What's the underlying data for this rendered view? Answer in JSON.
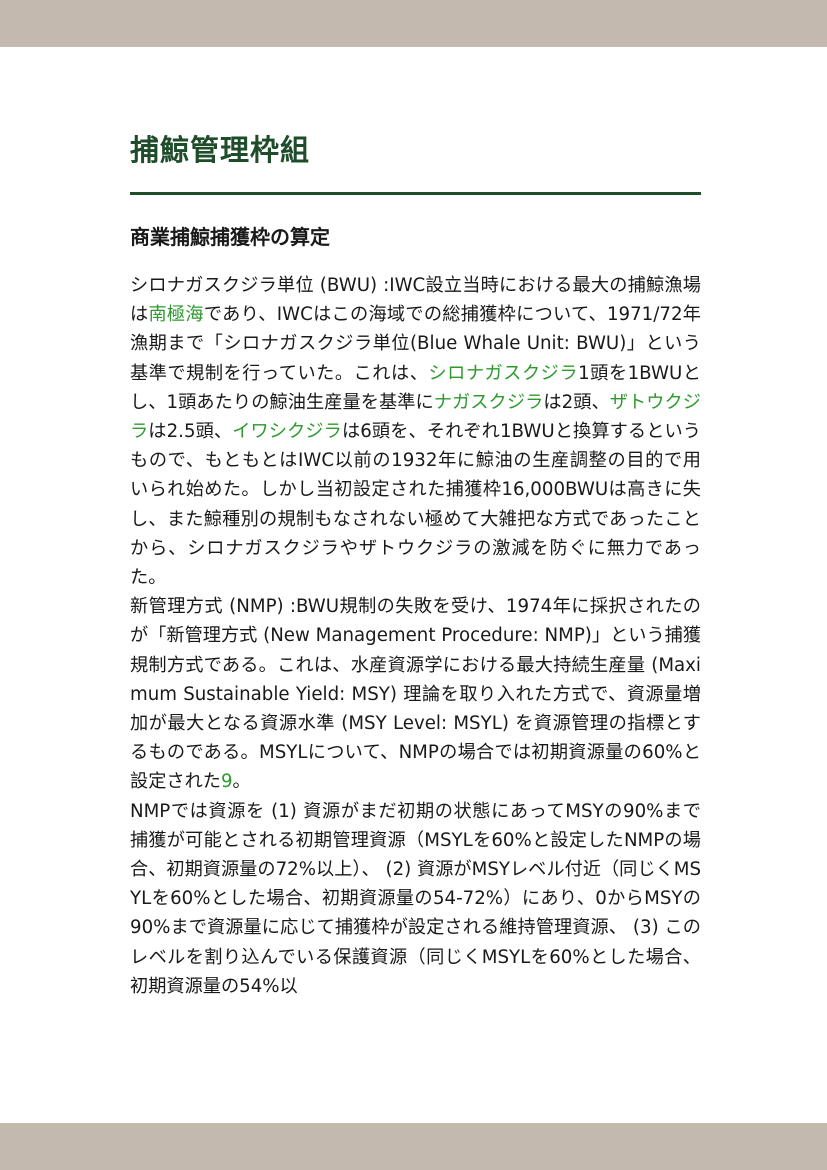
{
  "section_title": "捕鯨管理枠組",
  "subsection_title": "商業捕鯨捕獲枠の算定",
  "paragraphs": [
    [
      {
        "t": "シロナガスクジラ単位 (BWU) :IWC設立当時における最大の捕鯨漁場は"
      },
      {
        "t": "南極海",
        "link": true
      },
      {
        "t": "であり、IWCはこの海域での総捕獲枠について、1971/72年漁期まで「シロナガスクジラ単位(Blue Whale Unit: BWU)」という基準で規制を行っていた。これは、"
      },
      {
        "t": "シロナガスクジラ",
        "link": true
      },
      {
        "t": "1頭を1BWUとし、1頭あたりの鯨油生産量を基準に"
      },
      {
        "t": "ナガスクジラ",
        "link": true
      },
      {
        "t": "は2頭、"
      },
      {
        "t": "ザトウクジラ",
        "link": true
      },
      {
        "t": "は2.5頭、"
      },
      {
        "t": "イワシクジラ",
        "link": true
      },
      {
        "t": "は6頭を、それぞれ1BWUと換算するというもので、もともとはIWC以前の1932年に鯨油の生産調整の目的で用いられ始めた。しかし当初設定された捕獲枠16,000BWUは高きに失し、また鯨種別の規制もなされない極めて大雑把な方式であったことから、シロナガスクジラやザトウクジラの激減を防ぐに無力であった。"
      }
    ],
    [
      {
        "t": "新管理方式 (NMP) :BWU規制の失敗を受け、1974年に採択されたのが「新管理方式 (New Management Procedure: NMP)」という捕獲規制方式である。これは、水産資源学における最大持続生産量 (Maximum Sustainable Yield: MSY) 理論を取り入れた方式で、資源量増加が最大となる資源水準 (MSY Level: MSYL) を資源管理の指標とするものである。MSYLについて、NMPの場合では初期資源量の60%と設定された"
      },
      {
        "t": "9",
        "link": true
      },
      {
        "t": "。"
      }
    ],
    [
      {
        "t": "NMPでは資源を (1) 資源がまだ初期の状態にあってMSYの90%まで捕獲が可能とされる初期管理資源（MSYLを60%と設定したNMPの場合、初期資源量の72%以上）、 (2) 資源がMSYレベル付近（同じくMSYLを60%とした場合、初期資源量の54-72%）にあり、0からMSYの90%まで資源量に応じて捕獲枠が設定される維持管理資源、 (3) このレベルを割り込んでいる保護資源（同じくMSYLを60%とした場合、初期資源量の54%以"
      }
    ]
  ]
}
